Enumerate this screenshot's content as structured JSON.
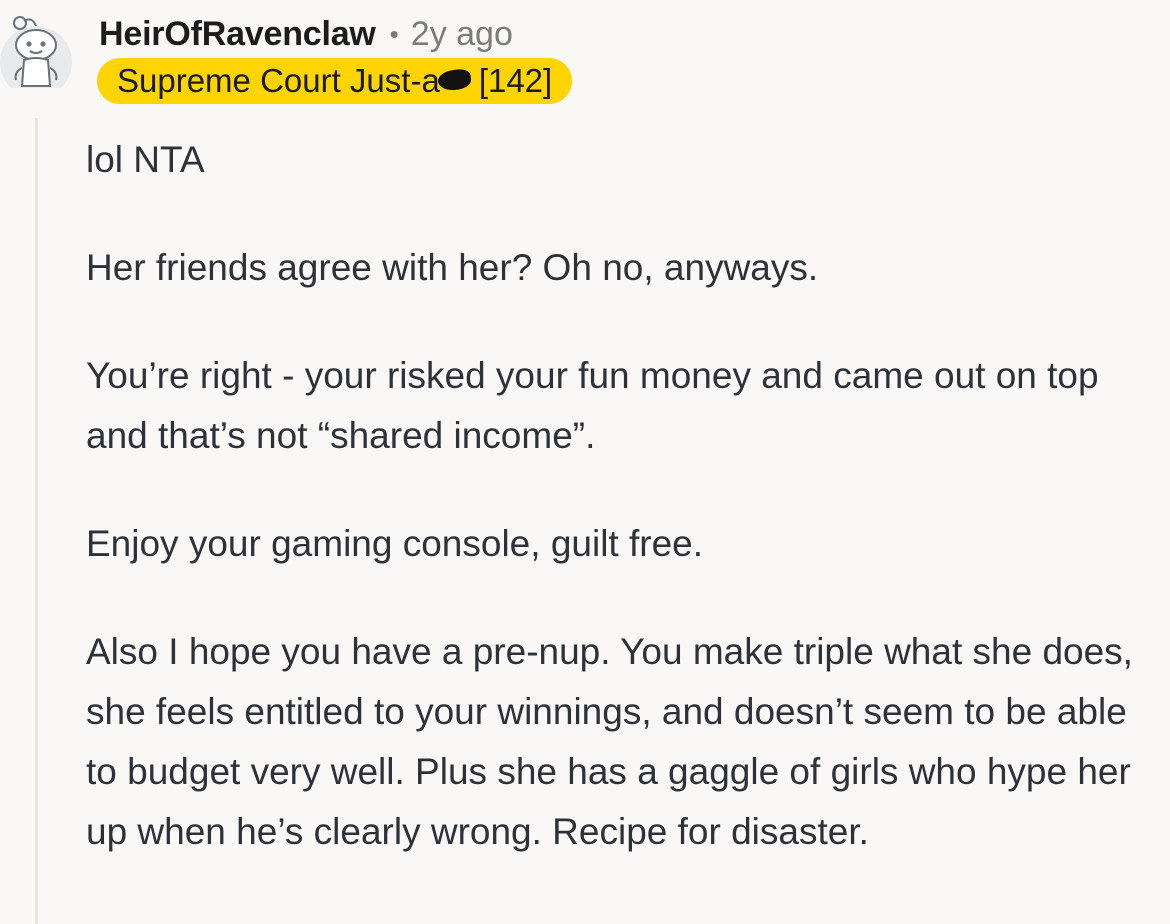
{
  "comment": {
    "username": "HeirOfRavenclaw",
    "separator": "•",
    "timestamp": "2y ago",
    "flair": {
      "text_before": "Supreme Court Just-a",
      "text_after": "[142]",
      "background": "#ffd400",
      "censored_segment": "censor-mark"
    },
    "avatar_icon": "snoo-avatar-icon",
    "paragraphs": [
      "lol NTA",
      "Her friends agree with her? Oh no, anyways.",
      "You’re right - your risked your fun money and came out on top and that’s not “shared income”.",
      "Enjoy your gaming console, guilt free.",
      "Also I hope you have a pre-nup. You make triple what she does, she feels entitled to your winnings, and doesn’t seem to be able to budget very well. Plus she has a gaggle of girls who hype her up when he’s clearly wrong. Recipe for disaster."
    ]
  }
}
